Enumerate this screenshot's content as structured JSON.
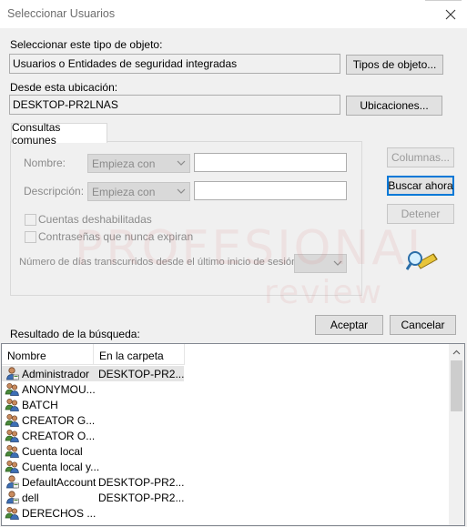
{
  "window": {
    "title": "Seleccionar Usuarios"
  },
  "object_type": {
    "label": "Seleccionar este tipo de objeto:",
    "value": "Usuarios o Entidades de seguridad integradas",
    "button": "Tipos de objeto..."
  },
  "location": {
    "label": "Desde esta ubicación:",
    "value": "DESKTOP-PR2LNAS",
    "button": "Ubicaciones..."
  },
  "common_queries": {
    "tab_label": "Consultas comunes",
    "name_label": "Nombre:",
    "name_combo": "Empieza con",
    "description_label": "Descripción:",
    "description_combo": "Empieza con",
    "disabled_accounts": "Cuentas deshabilitadas",
    "non_expiring": "Contraseñas que nunca expiran",
    "days_label": "Número de días transcurridos desde el último inicio de sesión:"
  },
  "side_buttons": {
    "columns": "Columnas...",
    "search_now": "Buscar ahora",
    "stop": "Detener"
  },
  "dialog_buttons": {
    "accept": "Aceptar",
    "cancel": "Cancelar"
  },
  "results": {
    "label": "Resultado de la búsqueda:",
    "columns": [
      "Nombre",
      "En la carpeta"
    ],
    "rows": [
      {
        "name": "Administrador",
        "folder": "DESKTOP-PR2...",
        "icon": "user-icon",
        "selected": true
      },
      {
        "name": "ANONYMOU...",
        "folder": "",
        "icon": "group-icon"
      },
      {
        "name": "BATCH",
        "folder": "",
        "icon": "group-icon"
      },
      {
        "name": "CREATOR G...",
        "folder": "",
        "icon": "group-icon"
      },
      {
        "name": "CREATOR O...",
        "folder": "",
        "icon": "group-icon"
      },
      {
        "name": "Cuenta local",
        "folder": "",
        "icon": "group-icon"
      },
      {
        "name": "Cuenta local y...",
        "folder": "",
        "icon": "group-icon"
      },
      {
        "name": "DefaultAccount",
        "folder": "DESKTOP-PR2...",
        "icon": "user-icon"
      },
      {
        "name": "dell",
        "folder": "DESKTOP-PR2...",
        "icon": "user-icon"
      },
      {
        "name": "DERECHOS ...",
        "folder": "",
        "icon": "group-icon"
      }
    ]
  },
  "watermark": {
    "line1": "PROFESIONAL",
    "line2": "review"
  },
  "colors": {
    "accent": "#0078d7",
    "dialog_bg": "#f0f0f0",
    "disabled_text": "#8a8a8a"
  }
}
